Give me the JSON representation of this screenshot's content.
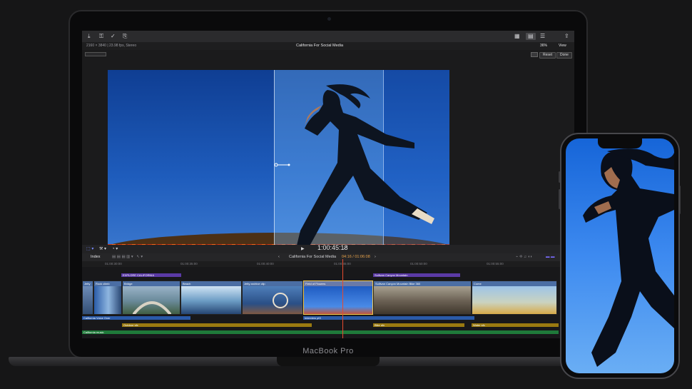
{
  "device_label": "MacBook Pro",
  "viewer": {
    "format_info": "2160 × 3840 | 23.98 fps, Stereo",
    "project_title": "California For Social Media",
    "zoom": "36%",
    "view_menu": "View",
    "reset_label": "Reset",
    "done_label": "Done"
  },
  "transport": {
    "timecode": "1:00:45:18"
  },
  "timeline": {
    "index_label": "Index",
    "project_name": "California For Social Media",
    "duration": "04:16 / 01:06:08",
    "ruler_ticks": [
      "01:00:30:00",
      "01:00:35:00",
      "01:00:40:00",
      "01:00:45:00",
      "01:00:50:00",
      "01:00:55:00"
    ],
    "titles": [
      {
        "label": "EXPLORE CALIFORNIA",
        "color": "#5b3aa6"
      },
      {
        "label": "Sullivan Canyon Mountain",
        "color": "#5b3aa6"
      }
    ],
    "clips": [
      "Jetty",
      "Rock climb",
      "Bridge",
      "Beach",
      "Jetty archive clip",
      "Field of Flowers",
      "Sullivan Canyon Mountain Bike 360",
      "Come"
    ],
    "audio_roles": [
      {
        "label": "California Voice Over",
        "color": "#2a5aa8"
      },
      {
        "label": "Interview pt3",
        "color": "#2a5aa8"
      },
      {
        "label": "Outdoor sfx",
        "color": "#9a7a10"
      },
      {
        "label": "Bike sfx",
        "color": "#9a7a10"
      },
      {
        "label": "Water sfx",
        "color": "#9a7a10"
      },
      {
        "label": "California music",
        "color": "#1f7a3a"
      }
    ]
  }
}
